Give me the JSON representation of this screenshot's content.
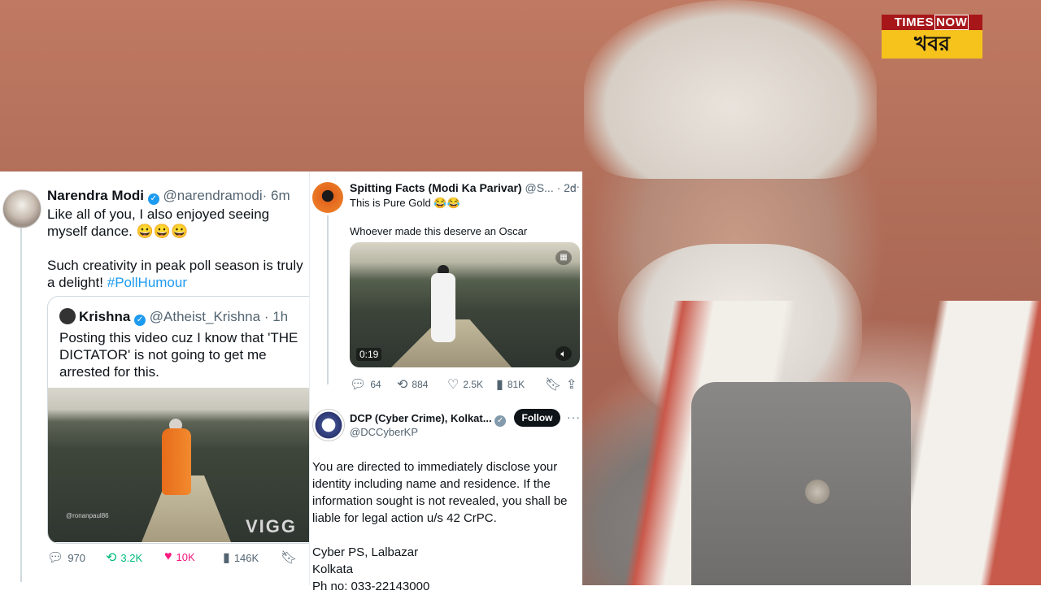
{
  "brand": {
    "top_times": "TIMES",
    "top_now": "NOW",
    "bottom": "খবর",
    "colors": {
      "red": "#a7171a",
      "yellow": "#f6c21c"
    }
  },
  "left_tweet": {
    "name": "Narendra Modi",
    "handle": "@narendramodi",
    "time": "· 6m",
    "text_line1": "Like all of you, I also enjoyed seeing myself dance. 😀😀😀",
    "text_line2_a": "Such creativity in peak poll season is truly a delight!",
    "hashtag": "#PollHumour",
    "quote": {
      "name": "Krishna",
      "handle": "@Atheist_Krishna",
      "time": "· 1h",
      "text": "Posting this video cuz I know that 'THE DICTATOR' is not going to get me arrested for this.",
      "video_watermark": "@ronanpaul86",
      "video_logo": "VIGG"
    },
    "actions": {
      "replies": "970",
      "reposts": "3.2K",
      "likes": "10K",
      "views": "146K"
    }
  },
  "right_tweet1": {
    "name": "Spitting Facts (Modi Ka Parivar)",
    "handle_time": "@S... · 2d",
    "line1": "This is Pure Gold 😂😂",
    "line2": "Whoever made this deserve an Oscar",
    "video_duration": "0:19",
    "actions": {
      "replies": "64",
      "reposts": "884",
      "likes": "2.5K",
      "views": "81K"
    }
  },
  "right_tweet2": {
    "name": "DCP (Cyber Crime), Kolkat...",
    "handle": "@DCCyberKP",
    "follow_label": "Follow",
    "text": "You are directed to immediately disclose your identity including name and residence. If the information sought is not revealed, you shall be liable for legal action u/s 42 CrPC.",
    "sign1": "Cyber PS, Lalbazar",
    "sign2": "Kolkata",
    "sign3": "Ph no: 033-22143000"
  },
  "icons": {
    "reply": "reply-icon",
    "repost": "repost-icon",
    "like": "heart-icon",
    "views": "views-icon",
    "bookmark": "bookmark-icon",
    "share": "share-icon"
  }
}
